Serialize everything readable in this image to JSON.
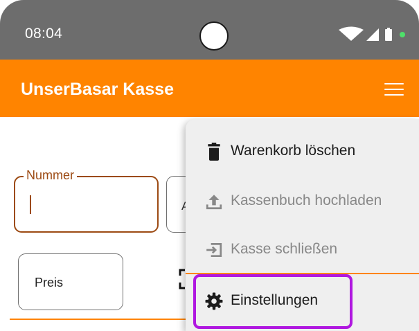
{
  "status_bar": {
    "time": "08:04",
    "icons": [
      "wifi-icon",
      "signal-icon",
      "battery-icon",
      "notification-dot-icon"
    ]
  },
  "app_bar": {
    "title": "UnserBasar Kasse",
    "menu_icon": "hamburger-menu-icon"
  },
  "form": {
    "nummer_label": "Nummer",
    "nummer_value": "",
    "second_field_visible_text": "A",
    "preis_label": "Preis"
  },
  "menu": {
    "items": [
      {
        "label": "Warenkorb löschen",
        "icon": "trash-icon",
        "enabled": true
      },
      {
        "label": "Kassenbuch hochladen",
        "icon": "upload-icon",
        "enabled": false
      },
      {
        "label": "Kasse schließen",
        "icon": "logout-icon",
        "enabled": false
      },
      {
        "label": "Einstellungen",
        "icon": "gear-icon",
        "enabled": true,
        "highlighted": true
      }
    ]
  },
  "colors": {
    "app_bar": "#ff8400",
    "status_bar": "#6d6d6d",
    "field_focus": "#9c4a13",
    "highlight": "#b018e0",
    "menu_bg": "#efefef",
    "disabled_text": "#888888"
  }
}
